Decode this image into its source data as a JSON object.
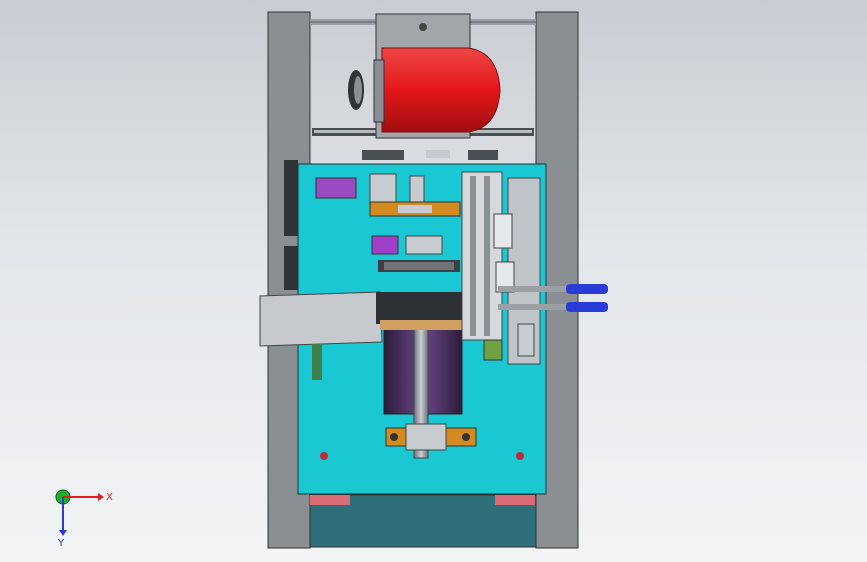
{
  "viewport": {
    "background_top": "#c9cdd3",
    "background_bottom": "#f3f4f6"
  },
  "triad": {
    "x_label": "X",
    "y_label": "Y",
    "x_color": "#e02020",
    "y_color": "#2a3cd8",
    "origin_color": "#19b02b"
  },
  "colors": {
    "frame": "#8a8f93",
    "frame_dark": "#5b6065",
    "plate": "#19c8d2",
    "motor": "#e3171a",
    "motor_dark": "#a10e10",
    "pink": "#e24f88",
    "purple": "#a040c8",
    "orange": "#d38a1e",
    "silver": "#b9bec4",
    "dark": "#3b3f44",
    "base": "#2f6f79"
  }
}
